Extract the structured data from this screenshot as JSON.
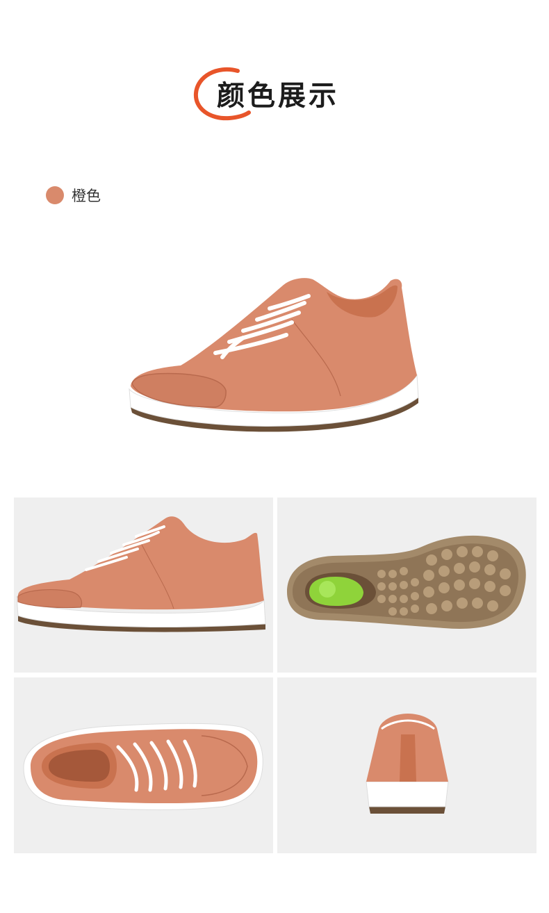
{
  "header": {
    "title": "颜色展示"
  },
  "colors": {
    "accent_scribble": "#e8552a",
    "leather": "#d98a6c",
    "leather_dark": "#b8694d",
    "sole_white": "#ffffff",
    "outsole_brown": "#6b5038",
    "tread_tan": "#a38a6a",
    "insert_green": "#8fd33a",
    "tile_bg": "#efefef"
  },
  "swatches": [
    {
      "name": "橙色",
      "color": "#d98a6c"
    }
  ],
  "gallery": {
    "views": [
      "side-view",
      "sole-view",
      "top-view",
      "back-view"
    ]
  }
}
